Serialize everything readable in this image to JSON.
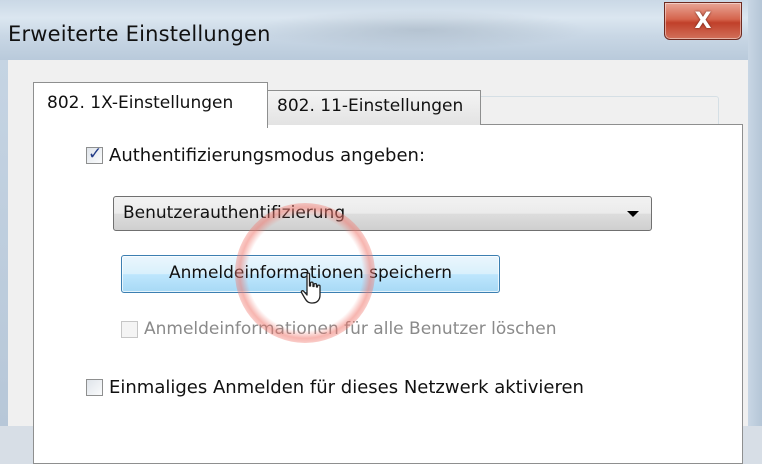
{
  "window": {
    "title": "Erweiterte Einstellungen",
    "close_symbol": "X"
  },
  "tabs": [
    {
      "label": "802. 1X-Einstellungen",
      "active": true
    },
    {
      "label": "802. 11-Einstellungen",
      "active": false
    }
  ],
  "auth_group": {
    "checkbox_label": "Authentifizierungsmodus angeben:",
    "checked": true,
    "dropdown_value": "Benutzerauthentifizierung",
    "save_button_label": "Anmeldeinformationen speichern",
    "delete_checkbox_label": "Anmeldeinformationen für alle Benutzer löschen",
    "delete_checked": false
  },
  "sso_group": {
    "checkbox_label": "Einmaliges Anmelden für dieses Netzwerk aktivieren",
    "checked": false
  },
  "colors": {
    "close_button": "#c9543c",
    "button_highlight": "#a7d9f5",
    "highlight_ring": "#f0786e"
  },
  "icons": {
    "cursor": "hand-pointer-icon",
    "dropdown": "chevron-down-icon"
  }
}
